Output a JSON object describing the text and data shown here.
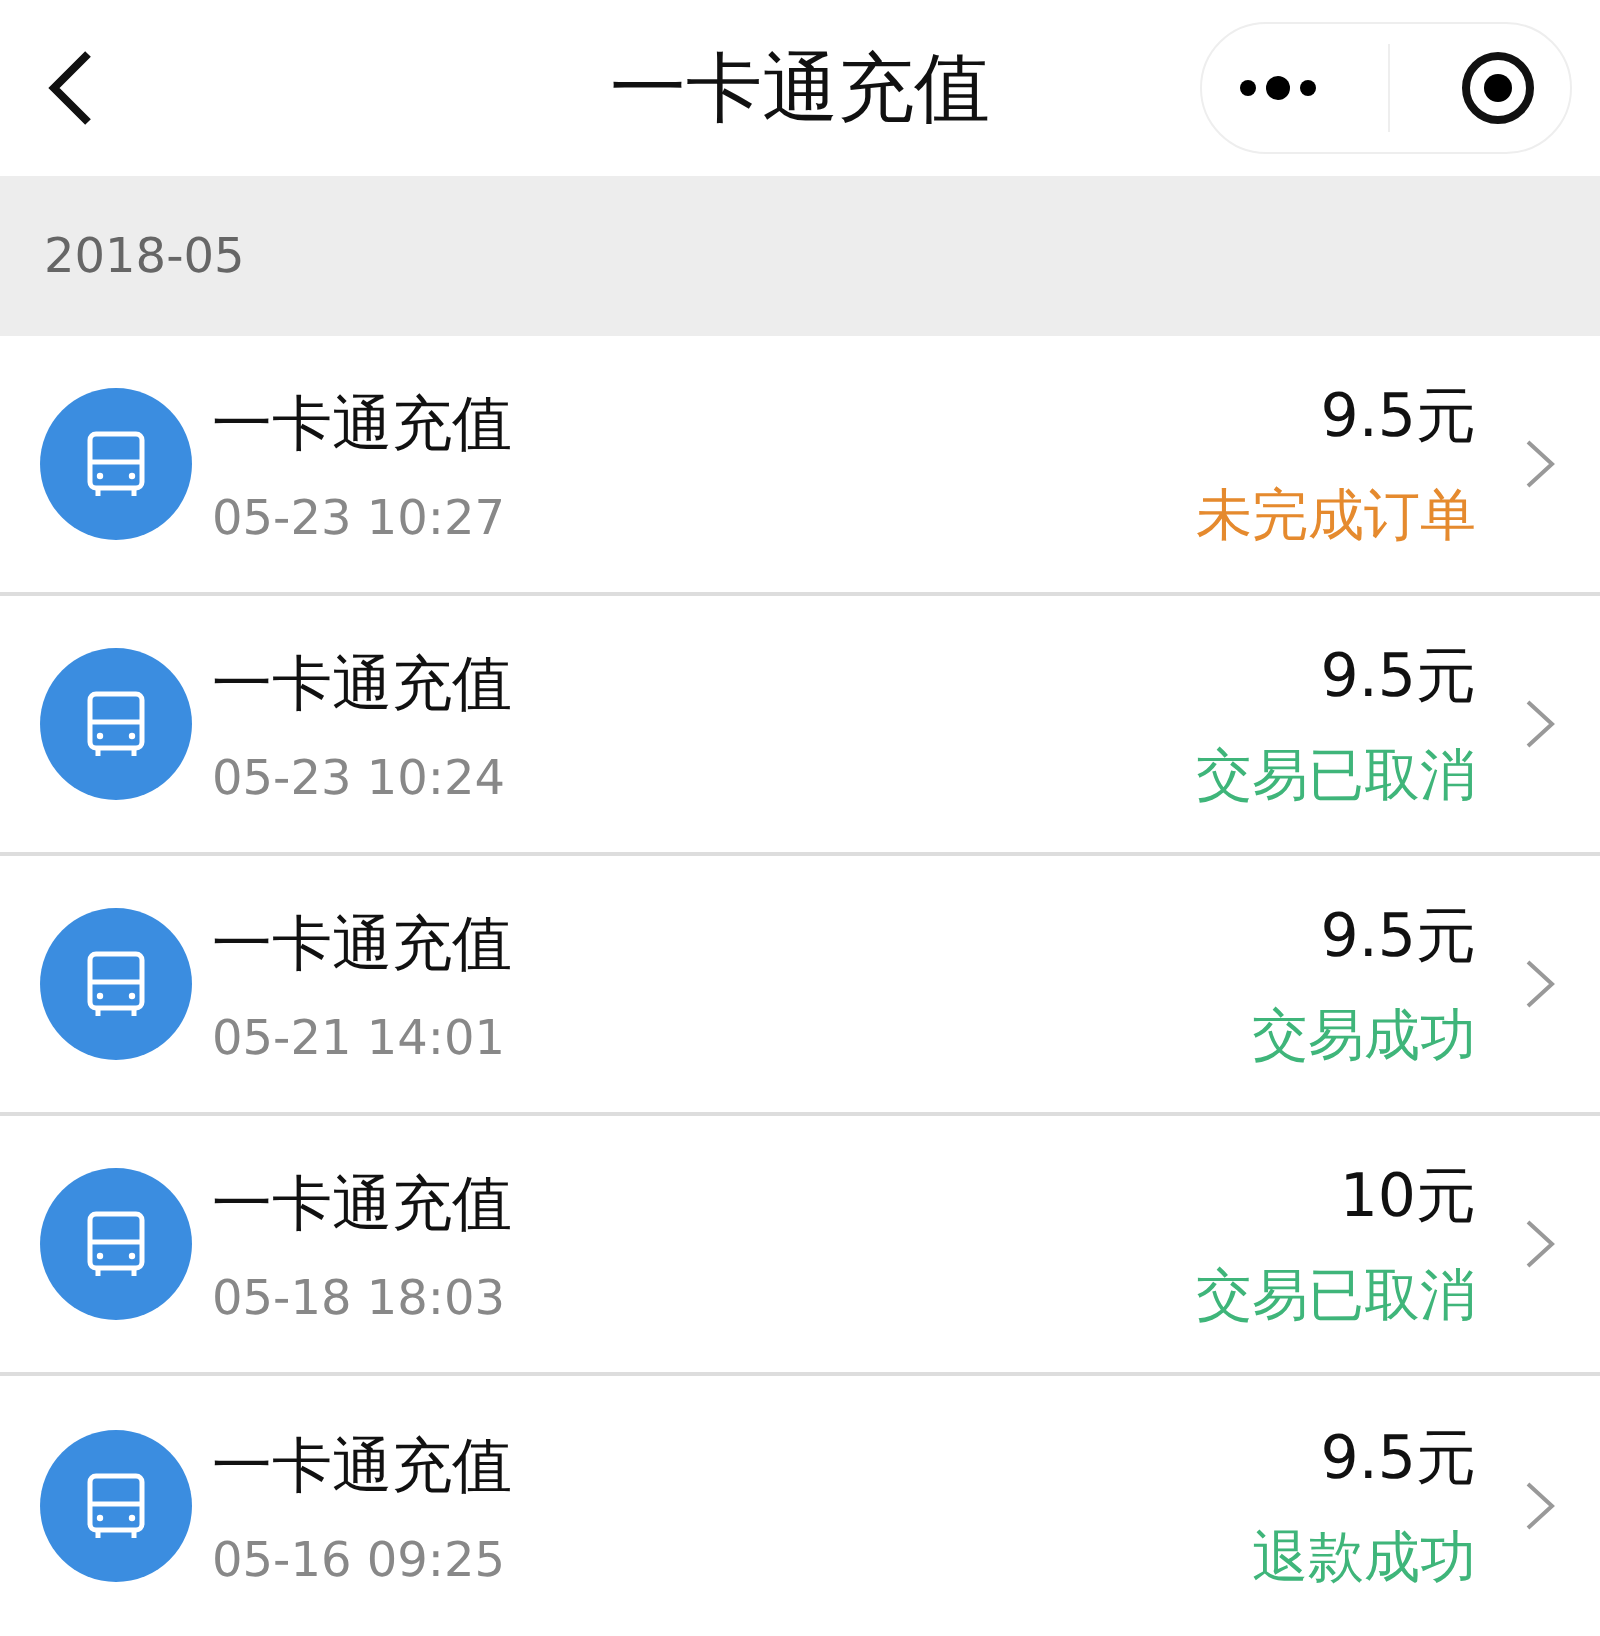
{
  "header": {
    "title": "一卡通充值"
  },
  "month": "2018-05",
  "records": [
    {
      "name": "一卡通充值",
      "time": "05-23 10:27",
      "amount": "9.5元",
      "status": "未完成订单",
      "color": "#e58a2e"
    },
    {
      "name": "一卡通充值",
      "time": "05-23 10:24",
      "amount": "9.5元",
      "status": "交易已取消",
      "color": "#3fb57a"
    },
    {
      "name": "一卡通充值",
      "time": "05-21 14:01",
      "amount": "9.5元",
      "status": "交易成功",
      "color": "#3fb57a"
    },
    {
      "name": "一卡通充值",
      "time": "05-18 18:03",
      "amount": "10元",
      "status": "交易已取消",
      "color": "#3fb57a"
    },
    {
      "name": "一卡通充值",
      "time": "05-16 09:25",
      "amount": "9.5元",
      "status": "退款成功",
      "color": "#3fb57a"
    }
  ]
}
